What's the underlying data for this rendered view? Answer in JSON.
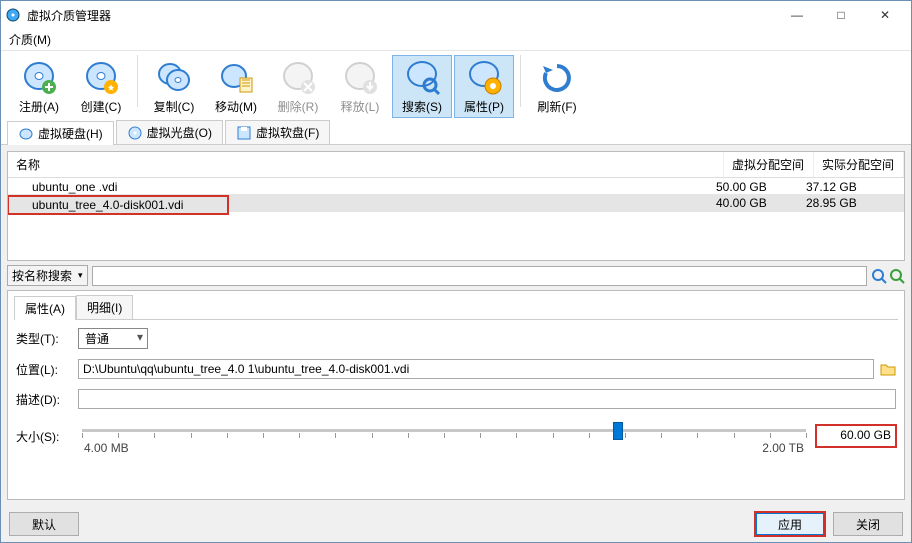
{
  "window": {
    "title": "虚拟介质管理器"
  },
  "menu": {
    "media": "介质(M)"
  },
  "toolbar": {
    "register": "注册(A)",
    "create": "创建(C)",
    "copy": "复制(C)",
    "move": "移动(M)",
    "delete": "删除(R)",
    "release": "释放(L)",
    "search": "搜索(S)",
    "properties": "属性(P)",
    "refresh": "刷新(F)"
  },
  "tabs": {
    "hdd": "虚拟硬盘(H)",
    "cd": "虚拟光盘(O)",
    "fd": "虚拟软盘(F)"
  },
  "columns": {
    "name": "名称",
    "virtual": "虚拟分配空间",
    "actual": "实际分配空间"
  },
  "rows": [
    {
      "name": "ubuntu_one .vdi",
      "virtual": "50.00 GB",
      "actual": "37.12 GB"
    },
    {
      "name": "ubuntu_tree_4.0-disk001.vdi",
      "virtual": "40.00 GB",
      "actual": "28.95 GB"
    }
  ],
  "search": {
    "mode": "按名称搜索",
    "value": ""
  },
  "ptabs": {
    "props": "属性(A)",
    "detail": "明细(I)"
  },
  "fields": {
    "type_label": "类型(T):",
    "type_value": "普通",
    "location_label": "位置(L):",
    "location_value": "D:\\Ubuntu\\qq\\ubuntu_tree_4.0 1\\ubuntu_tree_4.0-disk001.vdi",
    "desc_label": "描述(D):",
    "desc_value": "",
    "size_label": "大小(S):",
    "size_min": "4.00 MB",
    "size_max": "2.00 TB",
    "size_value": "60.00 GB",
    "thumb_pct": 74
  },
  "buttons": {
    "default": "默认",
    "apply": "应用",
    "close": "关闭"
  }
}
